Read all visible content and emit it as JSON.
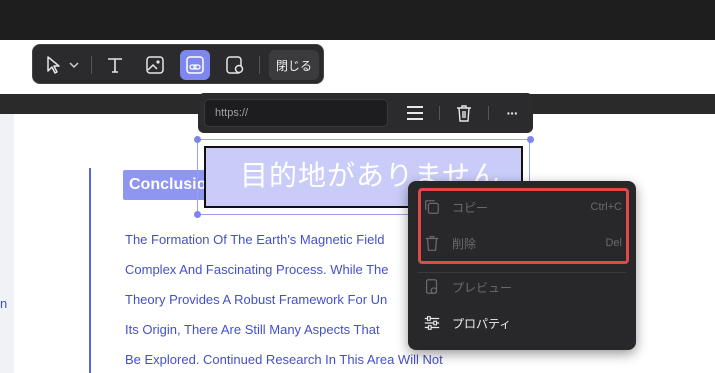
{
  "toolbar": {
    "close_label": "閉じる",
    "tools": [
      "select-arrow",
      "text-tool",
      "image-tool",
      "link-tool",
      "shape-tool"
    ]
  },
  "linkbar": {
    "url_placeholder": "https://",
    "buttons": [
      "align-menu",
      "delete",
      "more"
    ],
    "more_label": "···"
  },
  "document": {
    "heading": "Conclusion",
    "link_area_text": "目的地がありません",
    "left_fragment": "n",
    "lines": [
      "The Formation Of The Earth's Magnetic Field",
      "Complex And Fascinating Process. While The",
      "Theory Provides A Robust Framework For Un",
      "Its Origin, There Are Still Many Aspects That",
      "Be Explored. Continued Research In This Area Will Not"
    ]
  },
  "context_menu": {
    "items": [
      {
        "label": "コピー",
        "shortcut": "Ctrl+C",
        "icon": "copy-icon",
        "enabled": false
      },
      {
        "label": "削除",
        "shortcut": "Del",
        "icon": "trash-icon",
        "enabled": false
      },
      {
        "label": "プレビュー",
        "shortcut": "",
        "icon": "preview-icon",
        "enabled": false
      },
      {
        "label": "プロパティ",
        "shortcut": "",
        "icon": "properties-icon",
        "enabled": true
      }
    ]
  },
  "colors": {
    "accent": "#7b84ef",
    "text_blue": "#4450c9",
    "highlight_red": "#e0484a",
    "dark_panel": "#2b2b2e"
  }
}
